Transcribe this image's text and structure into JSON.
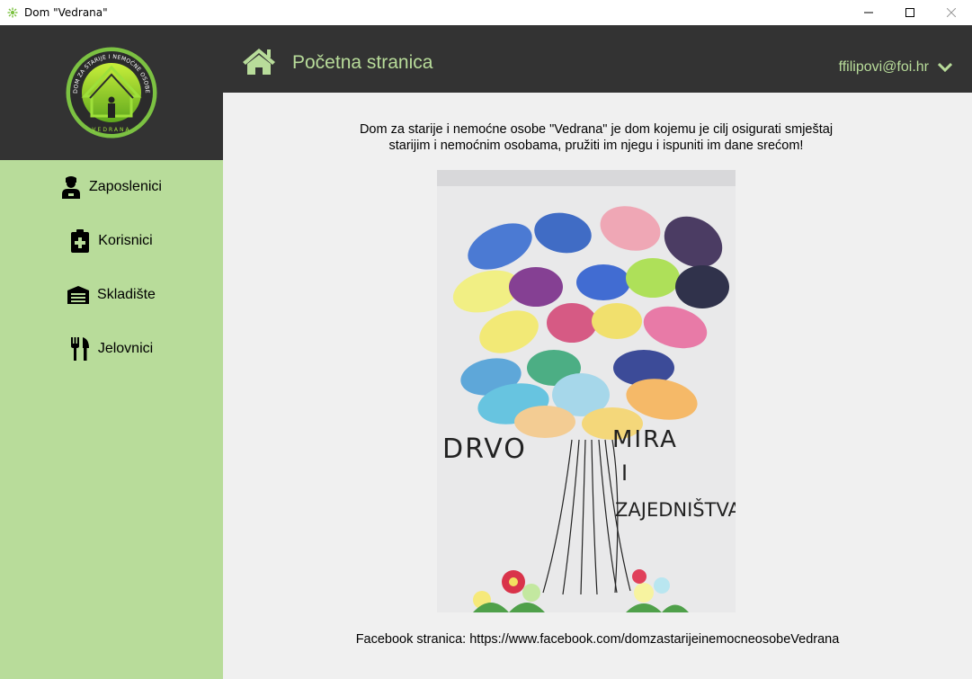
{
  "window": {
    "title": "Dom \"Vedrana\"",
    "controls": [
      "minimize",
      "maximize",
      "close"
    ]
  },
  "logo": {
    "arc_text": "DOM ZA STARIJE I NEMOĆNE OSOBE",
    "bottom_text": "VEDRANA"
  },
  "sidebar": {
    "items": [
      {
        "label": "Zaposlenici",
        "icon": "employee-icon"
      },
      {
        "label": "Korisnici",
        "icon": "clipboard-medical-icon"
      },
      {
        "label": "Skladište",
        "icon": "warehouse-icon"
      },
      {
        "label": "Jelovnici",
        "icon": "utensils-icon"
      }
    ]
  },
  "header": {
    "title": "Početna stranica",
    "user_email": "ffilipovi@foi.hr"
  },
  "main": {
    "intro_line1": "Dom za starije i nemoćne osobe \"Vedrana\" je dom kojemu je cilj osigurati smještaj",
    "intro_line2": "starijim i nemoćnim osobama, pružiti im njegu i ispuniti im dane srećom!",
    "photo_text": {
      "left": "DRVO",
      "right1": "MIRA",
      "right2": "I",
      "right3": "ZAJEDNIŠTVA"
    },
    "facebook": "Facebook stranica: https://www.facebook.com/domzastarijeinemocneosobeVedrana"
  },
  "colors": {
    "accent": "#b8dc9a",
    "dark": "#333333",
    "background": "#f0f0f0"
  }
}
